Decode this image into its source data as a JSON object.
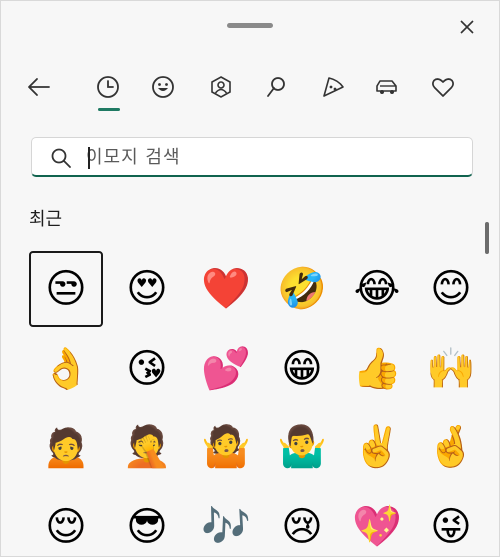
{
  "window": {
    "close_label": "✕"
  },
  "tabs": [
    {
      "id": "recent",
      "icon": "clock-icon",
      "selected": true
    },
    {
      "id": "smileys",
      "icon": "smiley-icon"
    },
    {
      "id": "people",
      "icon": "person-icon"
    },
    {
      "id": "nature",
      "icon": "leaf-icon"
    },
    {
      "id": "food",
      "icon": "pizza-icon"
    },
    {
      "id": "travel",
      "icon": "car-icon"
    },
    {
      "id": "symbols",
      "icon": "heart-icon"
    }
  ],
  "search": {
    "placeholder": "이모지 검색",
    "value": ""
  },
  "section": {
    "title": "최근"
  },
  "emojis": [
    "😒",
    "😍",
    "❤️",
    "🤣",
    "😂",
    "😊",
    "👌",
    "😘",
    "💕",
    "😁",
    "👍",
    "🙌",
    "🙍",
    "🤦",
    "🤷",
    "🤷‍♂️",
    "✌️",
    "🤞",
    "😌",
    "😎",
    "🎶",
    "😢",
    "💖",
    "😜"
  ],
  "accent_color": "#1f7a63"
}
